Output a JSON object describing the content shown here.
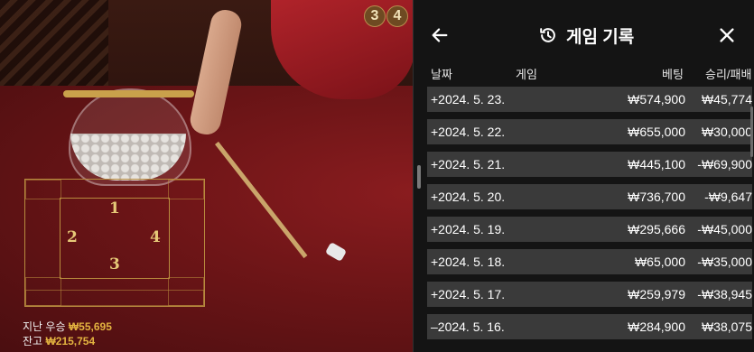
{
  "game_view": {
    "recent_results": [
      "3",
      "4"
    ],
    "board_numbers": [
      "1",
      "2",
      "3",
      "4"
    ],
    "last_win_label": "지난 우승",
    "last_win_amount": "₩55,695",
    "balance_label": "잔고",
    "balance_amount": "₩215,754"
  },
  "panel": {
    "title": "게임 기록",
    "back_icon": "arrow-left-icon",
    "history_icon": "history-icon",
    "close_icon": "close-icon",
    "columns": {
      "date": "날짜",
      "game": "게임",
      "bet": "베팅",
      "win_loss": "승리/패배"
    },
    "rows": [
      {
        "date": "+2024. 5. 23.",
        "bet": "₩574,900",
        "win_loss": "₩45,774"
      },
      {
        "date": "+2024. 5. 22.",
        "bet": "₩655,000",
        "win_loss": "₩30,000"
      },
      {
        "date": "+2024. 5. 21.",
        "bet": "₩445,100",
        "win_loss": "-₩69,900"
      },
      {
        "date": "+2024. 5. 20.",
        "bet": "₩736,700",
        "win_loss": "-₩9,647"
      },
      {
        "date": "+2024. 5. 19.",
        "bet": "₩295,666",
        "win_loss": "-₩45,000"
      },
      {
        "date": "+2024. 5. 18.",
        "bet": "₩65,000",
        "win_loss": "-₩35,000"
      },
      {
        "date": "+2024. 5. 17.",
        "bet": "₩259,979",
        "win_loss": "-₩38,945"
      },
      {
        "date": "–2024. 5. 16.",
        "bet": "₩284,900",
        "win_loss": "₩38,075"
      }
    ]
  },
  "colors": {
    "accent_gold": "#e3b340",
    "panel_bg": "#141414",
    "row_bg": "#3a3a3a"
  }
}
